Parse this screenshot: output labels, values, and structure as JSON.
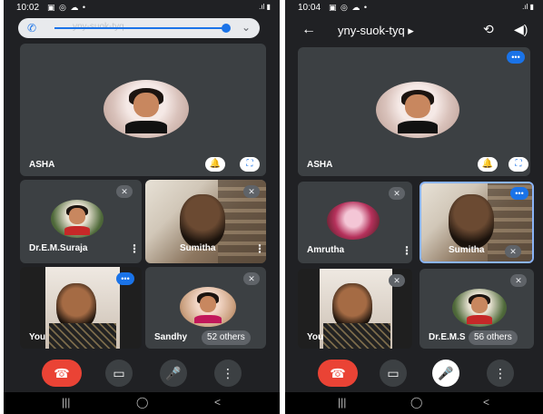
{
  "left": {
    "status": {
      "time": "10:02",
      "icons": "▣ ◎ ☁ •",
      "right": ".ıl ▮"
    },
    "callbar": {
      "phone_icon": "phone-icon",
      "faint_text": "yny-suok-tyq",
      "chevron": "⌄"
    },
    "main_tile": {
      "name": "ASHA",
      "pin_icon": "🔔",
      "expand_icon": "⛶"
    },
    "tiles": [
      {
        "name": "Dr.E.M.Suraja",
        "mute": "✕"
      },
      {
        "name": "Sumitha",
        "mute": "✕"
      },
      {
        "name": "You",
        "speaking": "•••"
      },
      {
        "name": "Sandhy",
        "others": "52 others",
        "mute": "✕"
      }
    ],
    "controls": {
      "end": "☎",
      "video": "▭",
      "mic": "🎤",
      "more": "⋮"
    },
    "nav": {
      "recents": "|||",
      "home": "◯",
      "back": "<"
    }
  },
  "right": {
    "status": {
      "time": "10:04",
      "icons": "▣ ◎ ☁ •",
      "right": ".ıl ▮"
    },
    "topbar": {
      "back": "←",
      "title": "yny-suok-tyq ▸",
      "switch": "⟲",
      "speaker": "◀)"
    },
    "main_tile": {
      "name": "ASHA",
      "speaking": "•••",
      "pin_icon": "🔔",
      "expand_icon": "⛶"
    },
    "tiles": [
      {
        "name": "Amrutha",
        "mute": "✕"
      },
      {
        "name": "Sumitha",
        "speaking": "•••",
        "mute": "✕"
      },
      {
        "name": "You",
        "mute": "✕"
      },
      {
        "name": "Dr.E.M.S",
        "others": "56 others",
        "mute": "✕"
      }
    ],
    "controls": {
      "end": "☎",
      "video": "▭",
      "mic": "🎤",
      "more": "⋮"
    },
    "nav": {
      "recents": "|||",
      "home": "◯",
      "back": "<"
    }
  }
}
